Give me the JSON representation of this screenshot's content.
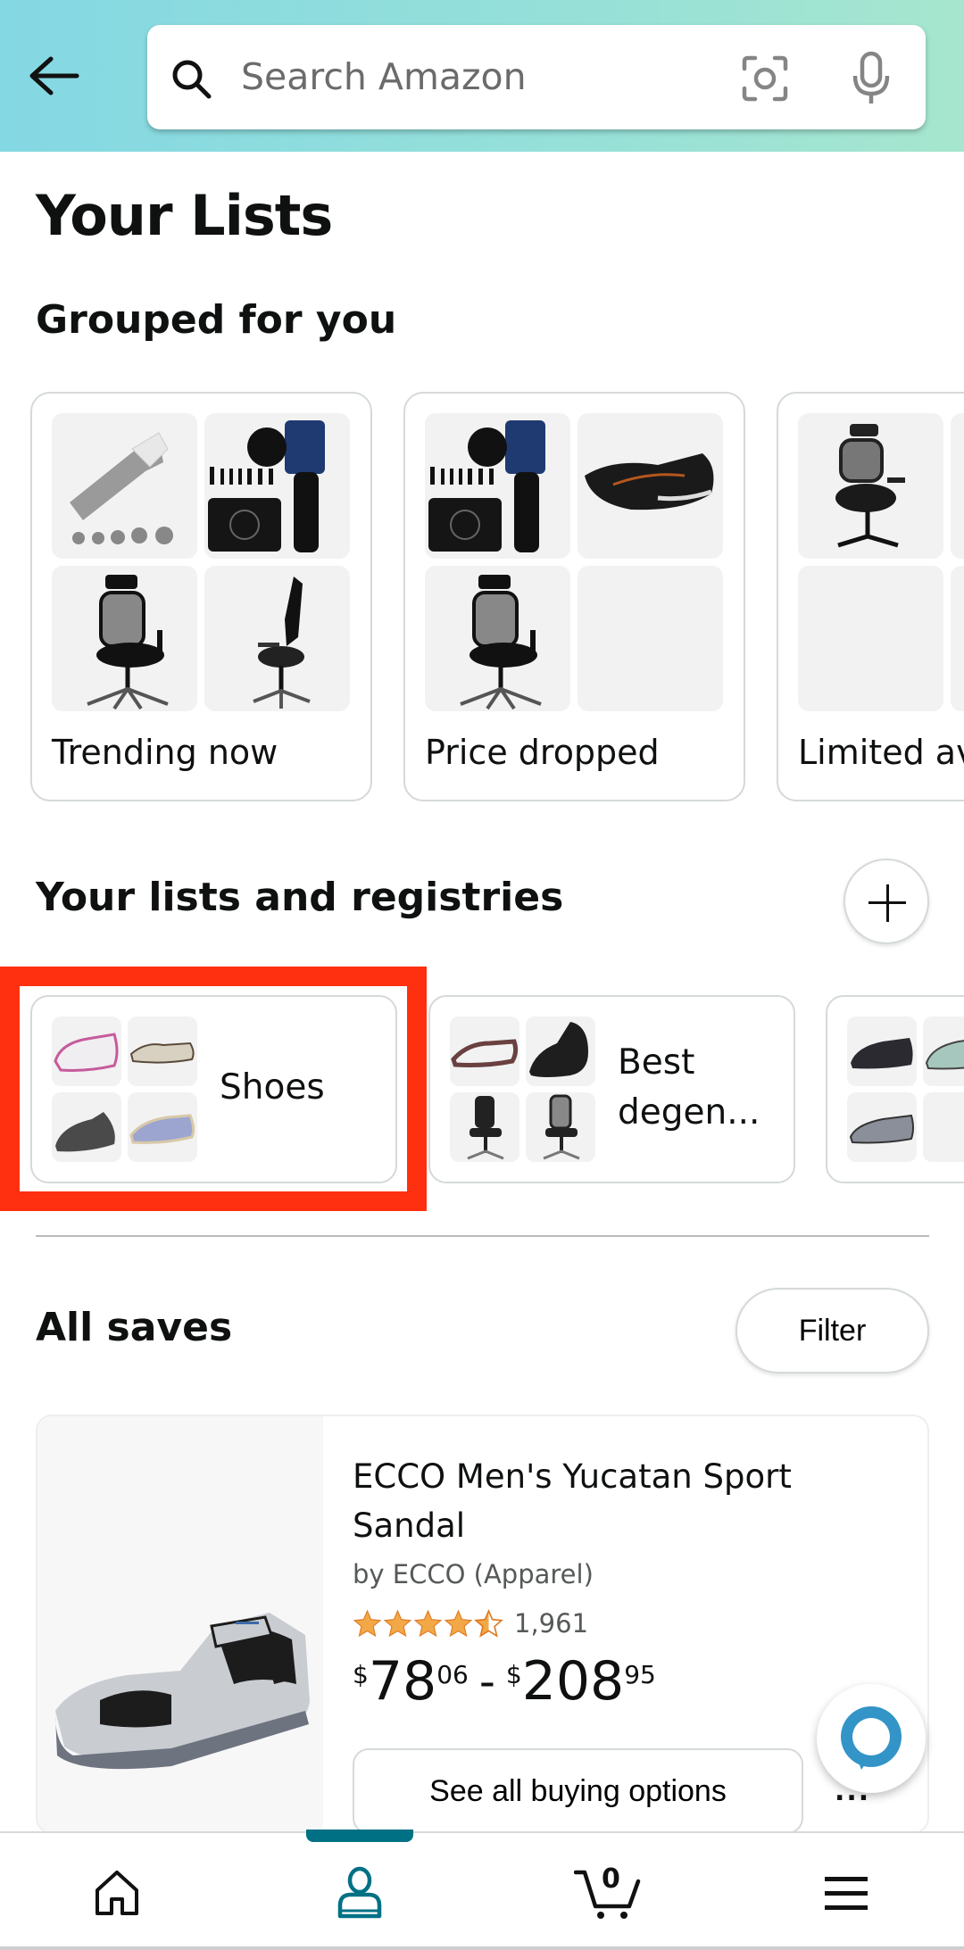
{
  "header": {
    "back_icon": "arrow-left-icon",
    "search_placeholder": "Search Amazon",
    "search_value": "",
    "icons": [
      "search-icon",
      "camera-lens-icon",
      "microphone-icon"
    ]
  },
  "page": {
    "title": "Your Lists"
  },
  "grouped": {
    "title": "Grouped for you",
    "cards": [
      {
        "label": "Trending now",
        "thumbnails": [
          "handheld massager",
          "massage gun kit",
          "mesh office chair",
          "mesh office chair side"
        ]
      },
      {
        "label": "Price dropped",
        "thumbnails": [
          "massage gun kit",
          "running shoe",
          "mesh office chair",
          ""
        ]
      },
      {
        "label": "Limited av",
        "thumbnails": [
          "mesh office chair",
          "",
          "",
          ""
        ]
      }
    ]
  },
  "lists": {
    "title": "Your lists and registries",
    "add_button_icon": "plus-icon",
    "cards": [
      {
        "label": "Shoes",
        "highlighted": true,
        "thumbnails": [
          "pink sneaker",
          "beige shoe",
          "gray slip-on",
          "blue sneaker"
        ]
      },
      {
        "label": "Best degen...",
        "highlighted": false,
        "thumbnails": [
          "sandal",
          "black high-top",
          "office chair",
          "office chair"
        ]
      },
      {
        "label": "",
        "highlighted": false,
        "thumbnails": [
          "black trail shoe",
          "green trail shoe",
          "gray running shoe",
          ""
        ]
      }
    ],
    "highlight_color": "#ff3010"
  },
  "saves": {
    "title": "All saves",
    "filter_label": "Filter",
    "items": [
      {
        "title": "ECCO Men's Yucatan Sport Sandal",
        "brand": "by ECCO (Apparel)",
        "rating": 4.5,
        "rating_max": 5,
        "rating_count": "1,961",
        "price_low": {
          "currency": "$",
          "whole": "78",
          "fraction": "06"
        },
        "price_high": {
          "currency": "$",
          "whole": "208",
          "fraction": "95"
        },
        "price_separator": "-",
        "button_label": "See all buying options",
        "more_label": "..."
      }
    ]
  },
  "alexa": {
    "icon": "alexa-icon"
  },
  "bottom_nav": {
    "items": [
      {
        "name": "home",
        "icon": "home-icon",
        "active": false
      },
      {
        "name": "you",
        "icon": "person-icon",
        "active": true
      },
      {
        "name": "cart",
        "icon": "cart-icon",
        "active": false,
        "count": "0"
      },
      {
        "name": "menu",
        "icon": "hamburger-menu-icon",
        "active": false
      }
    ],
    "active_color": "#007185"
  },
  "colors": {
    "star": "#f3a847",
    "accent": "#007185",
    "alexa": "#3294c7"
  }
}
